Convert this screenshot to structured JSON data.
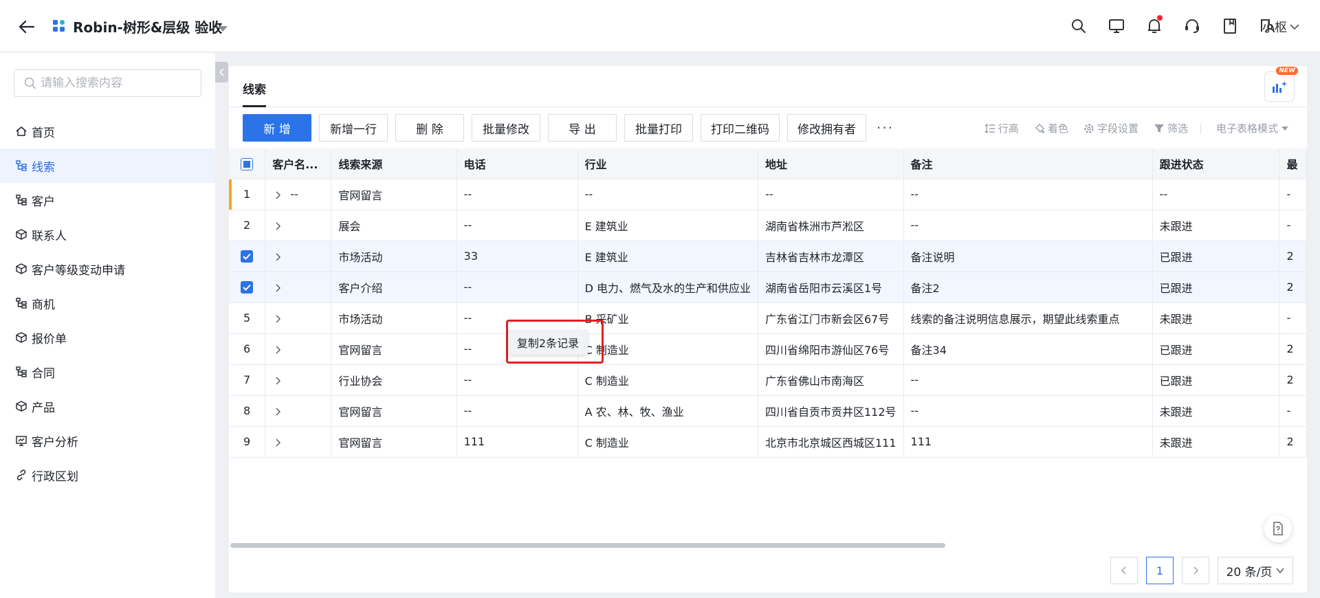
{
  "header": {
    "title": "Robin-树形&层级 验收",
    "user_name": "小枢",
    "icons": [
      "search-icon",
      "monitor-icon",
      "bell-icon",
      "support-icon",
      "book-icon",
      "export-user-icon"
    ]
  },
  "sidebar": {
    "search_placeholder": "请输入搜索内容",
    "items": [
      {
        "label": "首页",
        "icon": "home-icon",
        "active": false
      },
      {
        "label": "线索",
        "icon": "tree-icon",
        "active": true
      },
      {
        "label": "客户",
        "icon": "tree-icon",
        "active": false
      },
      {
        "label": "联系人",
        "icon": "cube-icon",
        "active": false
      },
      {
        "label": "客户等级变动申请",
        "icon": "cube-icon",
        "active": false
      },
      {
        "label": "商机",
        "icon": "tree-icon",
        "active": false
      },
      {
        "label": "报价单",
        "icon": "cube-icon",
        "active": false
      },
      {
        "label": "合同",
        "icon": "tree-icon",
        "active": false
      },
      {
        "label": "产品",
        "icon": "cube-icon",
        "active": false
      },
      {
        "label": "客户分析",
        "icon": "chart-icon",
        "active": false
      },
      {
        "label": "行政区划",
        "icon": "link-icon",
        "active": false
      }
    ]
  },
  "main": {
    "tab_label": "线索",
    "new_badge": "NEW",
    "toolbar": {
      "buttons": [
        "新 增",
        "新增一行",
        "删 除",
        "批量修改",
        "导 出",
        "批量打印",
        "打印二维码",
        "修改拥有者"
      ],
      "more": "···",
      "right": {
        "row_height": "行高",
        "color": "着色",
        "field_settings": "字段设置",
        "filter": "筛选",
        "mode": "电子表格模式"
      }
    },
    "table": {
      "columns": [
        "客户名...",
        "线索来源",
        "电话",
        "行业",
        "地址",
        "备注",
        "跟进状态",
        "最"
      ],
      "rows": [
        {
          "idx": "1",
          "name": "--",
          "source": "官网留言",
          "phone": "--",
          "industry": "--",
          "address": "--",
          "note": "--",
          "status": "--",
          "last": "-"
        },
        {
          "idx": "2",
          "name": "",
          "source": "展会",
          "phone": "--",
          "industry": "E 建筑业",
          "address": "湖南省株洲市芦淞区",
          "note": "--",
          "status": "未跟进",
          "last": "-"
        },
        {
          "idx": "",
          "name": "",
          "source": "市场活动",
          "phone": "33",
          "industry": "E 建筑业",
          "address": "吉林省吉林市龙潭区",
          "note": "备注说明",
          "status": "已跟进",
          "last": "2"
        },
        {
          "idx": "",
          "name": "",
          "source": "客户介绍",
          "phone": "--",
          "industry": "D 电力、燃气及水的生产和供应业",
          "address": "湖南省岳阳市云溪区1号",
          "note": "备注2",
          "status": "已跟进",
          "last": "2"
        },
        {
          "idx": "5",
          "name": "",
          "source": "市场活动",
          "phone": "--",
          "industry": "B 采矿业",
          "address": "广东省江门市新会区67号",
          "note": "线索的备注说明信息展示，期望此线索重点",
          "status": "未跟进",
          "last": "-"
        },
        {
          "idx": "6",
          "name": "",
          "source": "官网留言",
          "phone": "--",
          "industry": "C 制造业",
          "address": "四川省绵阳市游仙区76号",
          "note": "备注34",
          "status": "已跟进",
          "last": "2"
        },
        {
          "idx": "7",
          "name": "",
          "source": "行业协会",
          "phone": "--",
          "industry": "C 制造业",
          "address": "广东省佛山市南海区",
          "note": "--",
          "status": "已跟进",
          "last": "2"
        },
        {
          "idx": "8",
          "name": "",
          "source": "官网留言",
          "phone": "--",
          "industry": "A 农、林、牧、渔业",
          "address": "四川省自贡市贡井区112号",
          "note": "--",
          "status": "未跟进",
          "last": "-"
        },
        {
          "idx": "9",
          "name": "",
          "source": "官网留言",
          "phone": "111",
          "industry": "C 制造业",
          "address": "北京市北京城区西城区111",
          "note": "111",
          "status": "未跟进",
          "last": "2"
        }
      ]
    },
    "context_menu": {
      "copy_label": "复制2条记录"
    },
    "pagination": {
      "current": "1",
      "page_size": "20 条/页"
    }
  },
  "colors": {
    "accent": "#2a73e8",
    "highlight_bar": "#f5a623",
    "red": "#e02020"
  }
}
